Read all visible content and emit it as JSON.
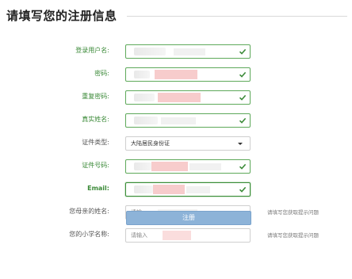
{
  "header": {
    "title": "请填写您的注册信息"
  },
  "form": {
    "fields": [
      {
        "label": "登录用户名:",
        "value": "",
        "placeholder": "",
        "state": "valid"
      },
      {
        "label": "密码:",
        "value": "",
        "placeholder": "",
        "state": "valid"
      },
      {
        "label": "重复密码:",
        "value": "",
        "placeholder": "",
        "state": "valid"
      },
      {
        "label": "真实姓名:",
        "value": "",
        "placeholder": "",
        "state": "valid"
      },
      {
        "label": "证件类型:",
        "value": "大陆居民身份证",
        "placeholder": "",
        "state": "select"
      },
      {
        "label": "证件号码:",
        "value": "",
        "placeholder": "",
        "state": "valid"
      },
      {
        "label": "Email:",
        "value": "",
        "placeholder": "",
        "state": "focus"
      },
      {
        "label": "您母亲的姓名:",
        "value": "",
        "placeholder": "请输",
        "state": "default",
        "hint": "请填写您获取提示问题"
      },
      {
        "label": "您的小学名称:",
        "value": "",
        "placeholder": "请输入",
        "state": "default",
        "hint": "请填写您获取提示问题"
      }
    ],
    "submit_label": "注册"
  },
  "colors": {
    "valid_label": "#3b8a38",
    "valid_border": "#5ea95a",
    "submit_bg": "#8db3d8"
  },
  "icons": {
    "valid": "check-icon",
    "select": "caret-down-icon"
  }
}
